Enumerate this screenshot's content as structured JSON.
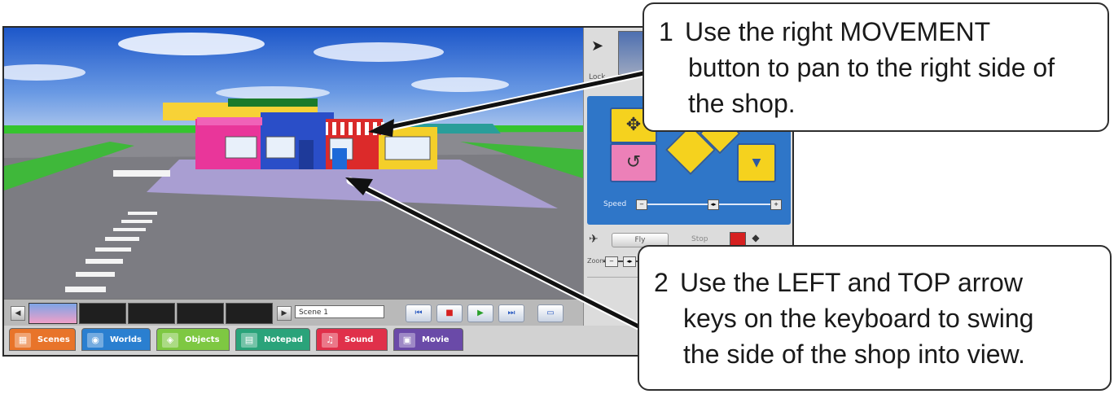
{
  "callouts": [
    {
      "number": "1",
      "lines": [
        "Use the right MOVEMENT",
        "button to pan to the right side of",
        "the shop."
      ]
    },
    {
      "number": "2",
      "lines": [
        "Use the LEFT and TOP arrow",
        "keys on the keyboard to swing",
        "the side of the shop into view."
      ]
    }
  ],
  "panel": {
    "lock_label": "Lock",
    "speed_label": "Speed",
    "fly_label": "Fly",
    "stop_label": "Stop",
    "zoom_label": "Zoom"
  },
  "scene_bar": {
    "scene_name": "Scene 1"
  },
  "tabs": [
    {
      "label": "Scenes",
      "icon": "scenes-icon",
      "color": "#e8742a"
    },
    {
      "label": "Worlds",
      "icon": "worlds-icon",
      "color": "#2a7fd0"
    },
    {
      "label": "Objects",
      "icon": "objects-icon",
      "color": "#7ec842"
    },
    {
      "label": "Notepad",
      "icon": "notepad-icon",
      "color": "#2aa37a"
    },
    {
      "label": "Sound",
      "icon": "sound-icon",
      "color": "#e0304a"
    },
    {
      "label": "Movie",
      "icon": "movie-icon",
      "color": "#6a4aa8"
    }
  ]
}
